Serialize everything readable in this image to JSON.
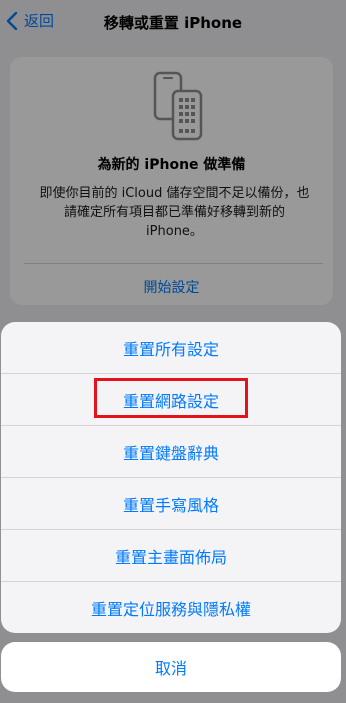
{
  "nav": {
    "back_label": "返回",
    "title": "移轉或重置 iPhone"
  },
  "card": {
    "icon": "phones-transfer-icon",
    "title": "為新的 iPhone 做準備",
    "description": "即使你目前的 iCloud 儲存空間不足以備份，也請確定所有項目都已準備好移轉到新的 iPhone。",
    "link": "開始設定"
  },
  "sheet": {
    "options": [
      "重置所有設定",
      "重置網路設定",
      "重置鍵盤辭典",
      "重置手寫風格",
      "重置主畫面佈局",
      "重置定位服務與隱私權"
    ],
    "cancel": "取消"
  },
  "colors": {
    "accent": "#007aff",
    "highlight": "#e3131d"
  }
}
